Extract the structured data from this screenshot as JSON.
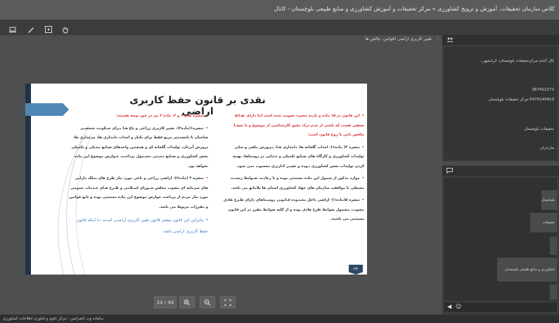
{
  "window": {
    "title": "کلاس سازمان تحقیقات، آموزش و ترویج کشاورزی » مرکز تحقیقات و آموزش کشاورزی و منابع طبیعی بلوچستان - کانال"
  },
  "presentation_panel": {
    "header": "تغییر کاربری اراضی (قوانین، چالش ها"
  },
  "slide": {
    "title": "نقدی بر قانون حفظ کاربری اراضی",
    "page_badge": "۲۴",
    "right_col": {
      "p1": "این قانون در ۱۵ ماده و یازده تبصره تصویب شده است اما دارای نقـاط ضعفی هست که ناشی از عدم درک دقیق کارشناسی از موضوع و یا بعضـا تناقض ذاتی با روح قانون است:",
      "p2": "تبصره ۴( ماده۱)- احداث گلخانه ها، دامداری هـا، پـرورش ماهی و سایر تولیدات کشاورزی و کارگاه های صنایع تکمیلی و غـذایی در روستاها، بهینه کردن تولیدات بخش کشاورزی بـوده و تغییـر کـاربری محسوب نمی شود.",
      "p3": "موارد مذکور از شمول این ماده مستثنی بوده و با رعایـت ضـوابط زیسـت محیطی با موافقت سازمان های جهاد کشاورزی استان ها بلامانع می باشد.",
      "p4": "تبصره ۵(ماده۱)- اراضی داخل محـدوده قـانونی روسـتاهای دارای طـرح هادی مصوب، مشمول ضوابط طرح هادی بوده و از کلیه ضوابط مقرر در این قانون مستثنی می باشند."
    },
    "left_col": {
      "p1": "تبصره های ۱ و ۴، ماده ۲ نیز در خور توجه هستند:",
      "p2": "تبصره۱(ماده۲)- تغییر کاربری زراعی و باغ هـا بـرای سـکونت شخصـی صاحبان تا پانصدمتر مربع فقط برای یکبار و احداث دامداری ها، مرغداری ها، پرورش آبزیان، تولیدات گلخانه ای و همچنین واحدهای صنایع تبدیلی و تکمیلی بخش کشاورزی و صنایع دسـتی مشـمول پرداخـت عـوارض موضوع این ماده نخواهد بود.",
      "p3": "تبصره ۴ (ماده۲)- اراضی زراعی و باغی مورد نیاز طرح های تملک دارایی های سرمایه ای مصوب مجلس شـورای اسـلامی و طـرح هـای خـدمات عمومی مورد نیاز مردم از پرداخت عوارض موضوع این ماده مستثنی بوده و تابع قوانین و مقررات مربوط می باشد.",
      "p4": "بنابراین این قانون بیشتر قانون تغییر کاربری اراضـی اسـت تـا اینکه قانون حفظ کاربری اراضی باشد."
    }
  },
  "nav": {
    "page": "24 / 44"
  },
  "attendees_panel": {
    "lines": [
      "کال آبادی-مرکزتحقیقات بلوچستان- ایرانشهر...",
      "367422272",
      "5970140910-مرکز تحقیقات بلوچستان",
      "تحقیقات بلوچستان",
      "مازندران"
    ]
  },
  "chat_panel": {
    "bubbles": [
      "بلوچستان",
      "تحقیقات بلوچستان",
      "کشاورزی و منابع طبیعی بلوچستان"
    ]
  },
  "status": {
    "text": "سامانه وب کنفرانس - مرکز علوم و فناوری اطلاعات کشاورزی"
  }
}
